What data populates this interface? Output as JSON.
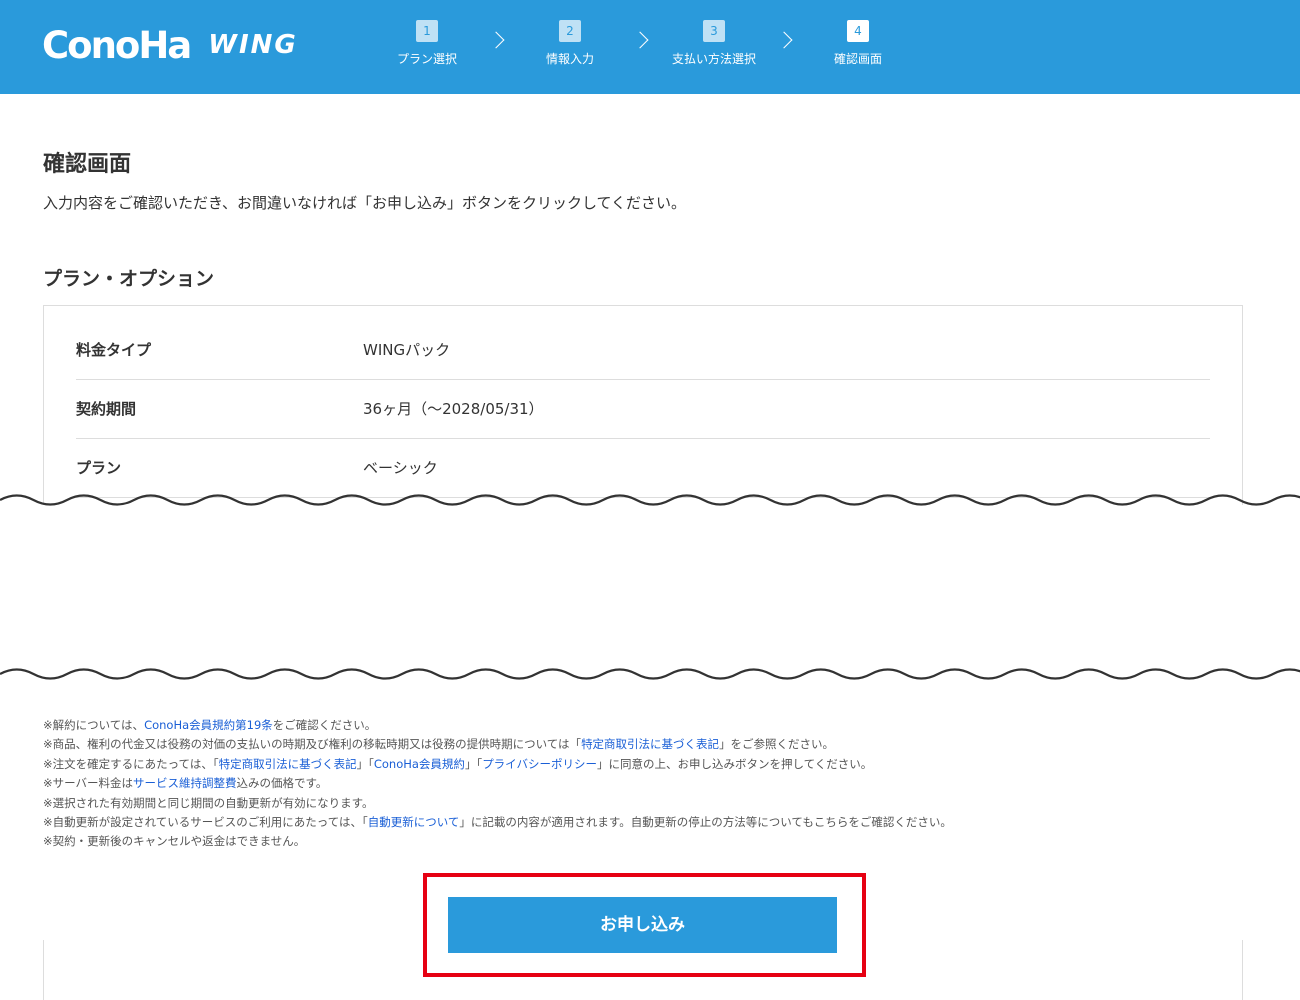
{
  "header": {
    "logo_main": "ConoHa",
    "logo_sub": "WING",
    "steps": [
      {
        "num": "1",
        "label": "プラン選択"
      },
      {
        "num": "2",
        "label": "情報入力"
      },
      {
        "num": "3",
        "label": "支払い方法選択"
      },
      {
        "num": "4",
        "label": "確認画面"
      }
    ],
    "active_step": "4",
    "color": "#2a9adb"
  },
  "main": {
    "title": "確認画面",
    "description": "入力内容をご確認いただき、お間違いなければ「お申し込み」ボタンをクリックしてください。",
    "section_title": "プラン・オプション",
    "rows": [
      {
        "label": "料金タイプ",
        "value": "WINGパック"
      },
      {
        "label": "契約期間",
        "value": "36ヶ月（〜2028/05/31）"
      },
      {
        "label": "プラン",
        "value": "ベーシック"
      }
    ]
  },
  "notes": {
    "n1_a": "※解約については、",
    "n1_link": "ConoHa会員規約第19条",
    "n1_b": "をご確認ください。",
    "n2_a": "※商品、権利の代金又は役務の対価の支払いの時期及び権利の移転時期又は役務の提供時期については「",
    "n2_link": "特定商取引法に基づく表記",
    "n2_b": "」をご参照ください。",
    "n3_a": "※注文を確定するにあたっては、「",
    "n3_link1": "特定商取引法に基づく表記",
    "n3_sep1": "」「",
    "n3_link2": "ConoHa会員規約",
    "n3_sep2": "」「",
    "n3_link3": "プライバシーポリシー",
    "n3_b": "」に同意の上、お申し込みボタンを押してください。",
    "n4_a": "※サーバー料金は",
    "n4_link": "サービス維持調整費",
    "n4_b": "込みの価格です。",
    "n5": "※選択された有効期間と同じ期間の自動更新が有効になります。",
    "n6_a": "※自動更新が設定されているサービスのご利用にあたっては、「",
    "n6_link": "自動更新について",
    "n6_b": "」に記載の内容が適用されます。自動更新の停止の方法等についてもこちらをご確認ください。",
    "n7": "※契約・更新後のキャンセルや返金はできません。"
  },
  "submit": {
    "label": "お申し込み",
    "highlight_color": "#e60012"
  }
}
